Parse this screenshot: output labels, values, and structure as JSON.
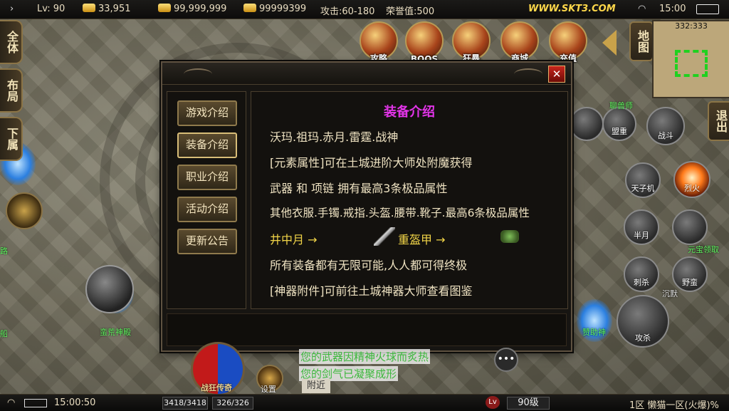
{
  "status_bar": {
    "level": "Lv: 90",
    "gold": "33,951",
    "ingot": "99,999,999",
    "bound_gold": "99999399",
    "attack": "攻击:60-180",
    "honor": "荣誉值:500",
    "site": "WWW.SKT3.COM",
    "time": "15:00"
  },
  "left_buttons": [
    "全体",
    "布局",
    "下属"
  ],
  "top_icons": [
    "攻略",
    "BOOS",
    "狂暴",
    "商城",
    "充值"
  ],
  "minimap": {
    "button": "地图",
    "coord": "332:333"
  },
  "right_buttons": {
    "exit": "退出"
  },
  "skills": [
    "聊兽师",
    "盟重",
    "战斗",
    "天子机",
    "烈火",
    "刺杀",
    "半月",
    "野蛮",
    "元宝领取",
    "沉默",
    "攻杀"
  ],
  "dialog": {
    "tabs": [
      "游戏介绍",
      "装备介绍",
      "职业介绍",
      "活动介绍",
      "更新公告"
    ],
    "close": "✕",
    "content": {
      "title": "装备介绍",
      "line1": "沃玛.祖玛.赤月.雷霆.战神",
      "line2": "[元素属性]可在土城进阶大师处附魔获得",
      "line3": "武器 和 项链 拥有最高3条极品属性",
      "line4": "其他衣服.手镯.戒指.头盔.腰带.靴子.最高6条极品属性",
      "link1": "井中月 →",
      "link2": "重盔甲 →",
      "line6": "所有装备都有无限可能,人人都可得终极",
      "line7": "[神器附件]可前往土城神器大师查看图鉴"
    }
  },
  "chat": {
    "msg1": "您的武器因精神火球而炙热",
    "msg2": "您的剑气已凝聚成形",
    "nearby": "附近"
  },
  "ground_labels": {
    "left_npc": "蛮荒神殿",
    "right_npc": "赞助神",
    "road": "路",
    "boat": "船",
    "bottom_logo": "战狂传奇",
    "set_label": "设置"
  },
  "bottom_bar": {
    "time": "15:00:50",
    "hp": "3418/3418",
    "mp": "326/326",
    "lv_badge": "Lv",
    "level": "90级",
    "server": "1区 懒猫一区(火爆)%"
  }
}
